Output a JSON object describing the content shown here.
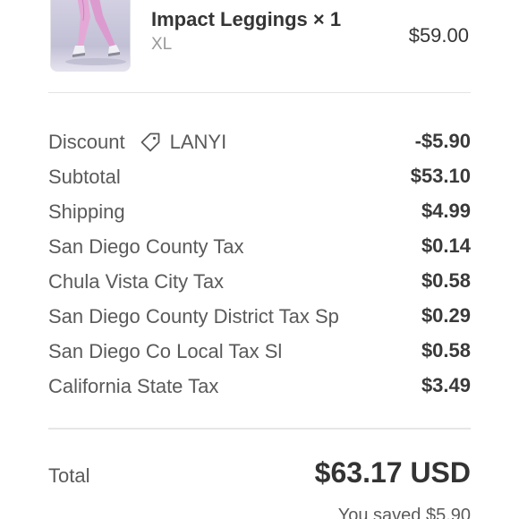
{
  "product": {
    "name": "Impact Leggings",
    "quantity_text": "× 1",
    "variant": "XL",
    "price": "$59.00",
    "image_icon": "product-photo-pink-leggings"
  },
  "summary": {
    "discount": {
      "label": "Discount",
      "code_icon": "tag-icon",
      "code": "LANYI",
      "value": "-$5.90"
    },
    "lines": [
      {
        "label": "Subtotal",
        "value": "$53.10"
      },
      {
        "label": "Shipping",
        "value": "$4.99"
      },
      {
        "label": "San Diego County Tax",
        "value": "$0.14"
      },
      {
        "label": "Chula Vista City Tax",
        "value": "$0.58"
      },
      {
        "label": "San Diego County District Tax Sp",
        "value": "$0.29"
      },
      {
        "label": "San Diego Co Local Tax Sl",
        "value": "$0.58"
      },
      {
        "label": "California State Tax",
        "value": "$3.49"
      }
    ]
  },
  "total": {
    "label": "Total",
    "value": "$63.17 USD",
    "saved_text": "You saved $5.90"
  },
  "colors": {
    "product_pink": "#e4a8d6",
    "text_dark": "#353535",
    "text_muted": "#9a9a9a",
    "divider": "#e3e3e3"
  }
}
